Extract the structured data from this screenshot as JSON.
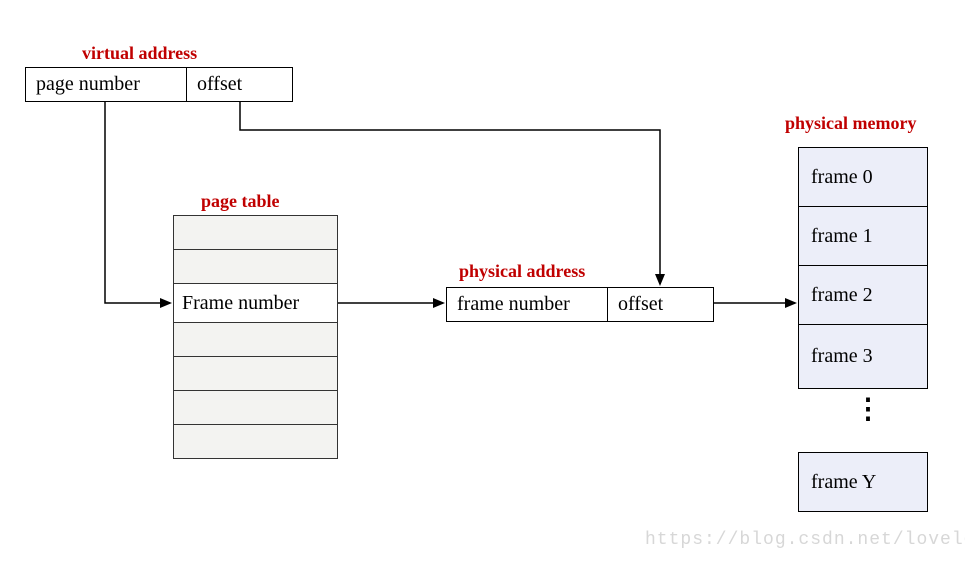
{
  "labels": {
    "virtual_address": "virtual address",
    "page_table": "page table",
    "physical_address": "physical address",
    "physical_memory": "physical memory"
  },
  "virtual_address": {
    "page_number": "page number",
    "offset": "offset"
  },
  "page_table": {
    "rows": [
      "",
      "",
      "Frame number",
      "",
      "",
      "",
      ""
    ]
  },
  "physical_address": {
    "frame_number": "frame number",
    "offset": "offset"
  },
  "physical_memory": {
    "frames": [
      "frame 0",
      "frame 1",
      "frame 2",
      "frame 3"
    ],
    "ellipsis": "⋮",
    "last": "frame Y"
  },
  "watermark": "https://blog.csdn.net/lovelease"
}
